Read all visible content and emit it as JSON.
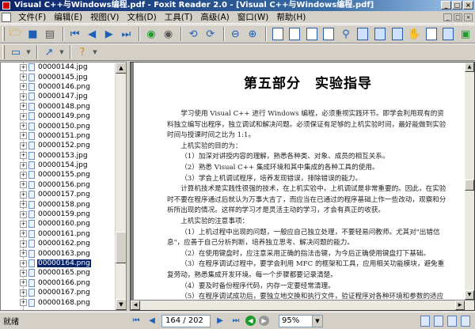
{
  "window": {
    "title": "Visual C++与Windows编程.pdf - Foxit Reader 2.0 - [Visual C++与Windows编程.pdf]",
    "buttons": [
      "_",
      "□",
      "×"
    ]
  },
  "menu": {
    "items": [
      "文件(F)",
      "编辑(E)",
      "视图(V)",
      "文档(D)",
      "工具(T)",
      "高级(A)",
      "窗口(W)",
      "帮助(H)"
    ],
    "mdi_buttons": [
      "_",
      "□",
      "×"
    ]
  },
  "icons": {
    "open": "folder-open-icon",
    "save": "save-icon",
    "print": "printer-icon",
    "first": "first-page-icon",
    "prev": "prev-page-icon",
    "next": "next-page-icon",
    "last": "last-page-icon",
    "back": "back-icon",
    "forward": "forward-icon",
    "hand": "hand-icon",
    "find": "binoculars-icon",
    "help": "help-icon"
  },
  "sidebar": {
    "files": [
      "00000144.jpg",
      "00000145.jpg",
      "00000146.png",
      "00000147.jpg",
      "00000148.png",
      "00000149.png",
      "00000150.png",
      "00000151.png",
      "00000152.png",
      "00000153.jpg",
      "00000154.jpg",
      "00000155.png",
      "00000156.png",
      "00000157.png",
      "00000158.png",
      "00000159.png",
      "00000160.png",
      "00000161.png",
      "00000162.png",
      "00000163.png",
      "00000164.png",
      "00000165.png",
      "00000166.png",
      "00000167.png",
      "00000168.png"
    ],
    "selected": "00000164.png"
  },
  "document": {
    "heading": "第五部分　实验指导",
    "paragraphs": [
      "学习使用 Visual C++ 进行 Windows 编程，必须重视实践环节。即学会利用现有的资料独立编写出程序，独立调试和解决问题。必须保证有足够的上机实验时间，最好能做到实验时间与授课时间之比为 1:1。",
      "上机实验的目的为：",
      "（1）加深对讲授内容的理解，熟悉各种类、对象、成员的相互关系。",
      "（2）熟悉 Visual C++ 集成环境和其中集成的各种工具的使用。",
      "（3）学会上机调试程序，培养发现错误，排除错误的能力。",
      "计算机技术是实践性很强的技术，在上机实验中，上机调试是非常重要的。因此，在实验时不要在程序通过后就认为万事大吉了，而应当在已通过的程序基础上作一些改动，观察和分析所出现的情况。这样的学习才是灵活主动的学习，才会有真正的收获。",
      "上机实验的注意事项：",
      "（1）上机过程中出现的问题，一般应自己独立处理，不要轻易问教师。尤其对\"出错信息\"，应善于自己分析判断，培养独立思考、解决问题的能力。",
      "（2）在使用键盘时，应注意采用正确的指法击键，为今后正确使用键盘打下基础。",
      "（3）在程序调试过程中，要学会利用 MFC 的框架和工具，应用相关功能模块，避免重复劳动，熟悉集成开发环境。每一个步骤都要记录清楚。",
      "（4）要及时备份程序代码，内存一定要经常清理。",
      "（5）在程序调试成功后，要独立地交换和执行文件，验证程序对各种环境和参数的适应性。"
    ]
  },
  "status": {
    "text": "就绪",
    "page": "164 / 202",
    "zoom": "95%"
  }
}
